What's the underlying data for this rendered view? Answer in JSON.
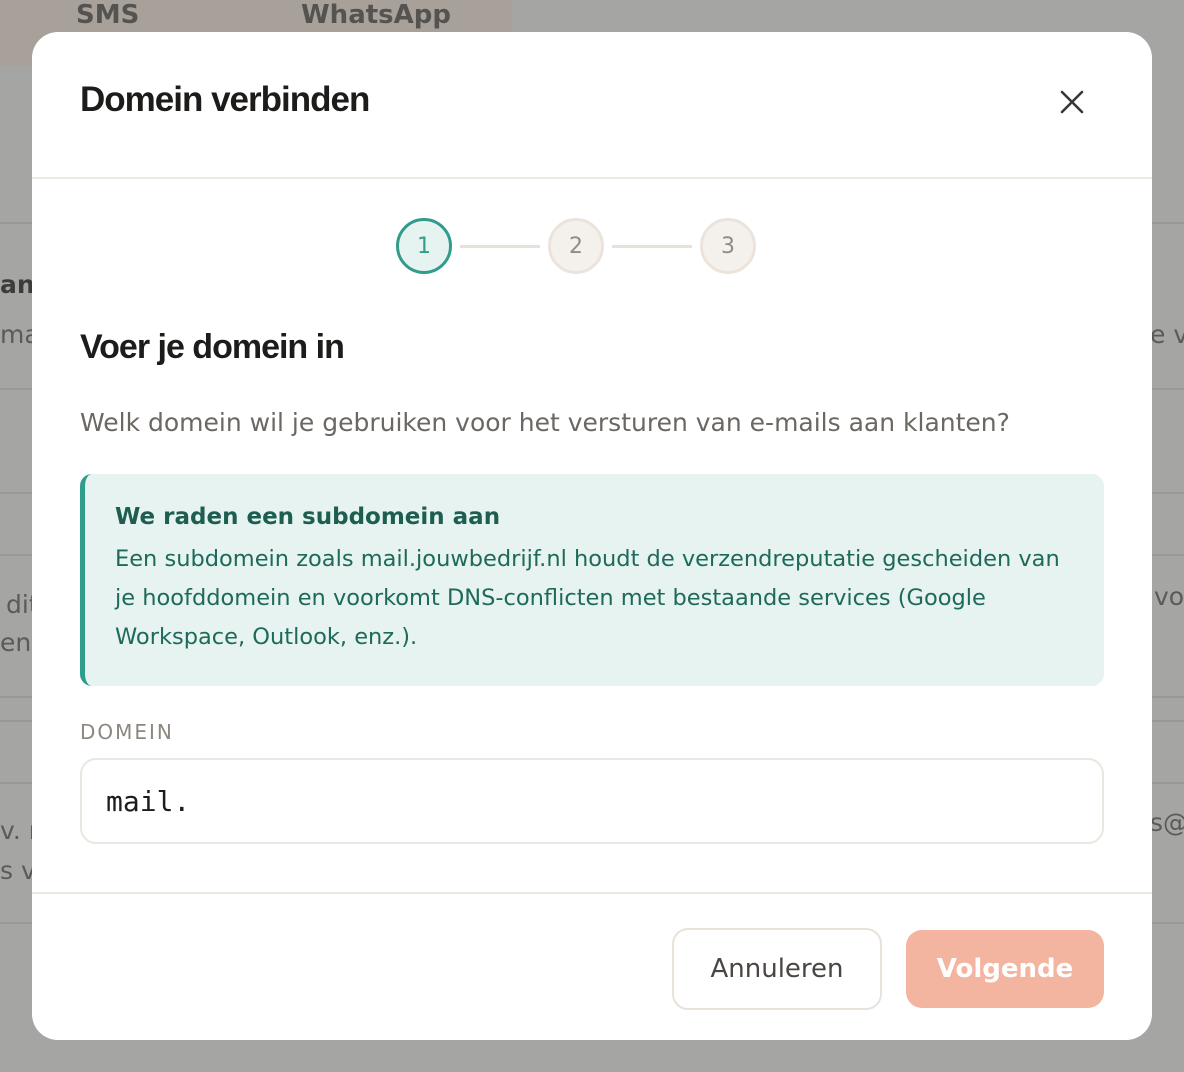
{
  "background": {
    "tabs": [
      "SMS",
      "WhatsApp"
    ],
    "fragments": [
      "ana",
      "ma",
      "dit",
      "en.",
      "v. n",
      "s va",
      "e v",
      "vo",
      "s@"
    ]
  },
  "modal": {
    "title": "Domein verbinden",
    "close_icon": "close-icon",
    "steps": [
      "1",
      "2",
      "3"
    ],
    "active_step": 1,
    "section_title": "Voer je domein in",
    "section_description": "Welk domein wil je gebruiken voor het versturen van e-mails aan klanten?",
    "info": {
      "title": "We raden een subdomein aan",
      "text": "Een subdomein zoals mail.jouwbedrijf.nl houdt de verzendreputatie gescheiden van je hoofddomein en voorkomt DNS-conflicten met bestaande services (Google Workspace, Outlook, enz.)."
    },
    "field_label": "DOMEIN",
    "domain_value": "mail.",
    "cancel_label": "Annuleren",
    "next_label": "Volgende"
  },
  "colors": {
    "accent": "#2f9c8c",
    "primary_button_disabled": "#f3b5a0",
    "info_background": "#e6f3f0"
  }
}
